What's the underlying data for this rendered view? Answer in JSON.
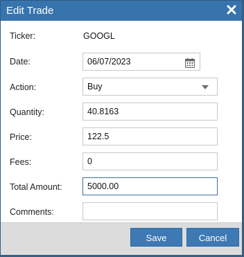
{
  "dialog": {
    "title": "Edit Trade",
    "close_icon": "close-icon"
  },
  "form": {
    "ticker_label": "Ticker:",
    "ticker_value": "GOOGL",
    "date_label": "Date:",
    "date_value": "06/07/2023",
    "date_icon": "calendar-icon",
    "action_label": "Action:",
    "action_value": "Buy",
    "quantity_label": "Quantity:",
    "quantity_value": "40.8163",
    "price_label": "Price:",
    "price_value": "122.5",
    "fees_label": "Fees:",
    "fees_value": "0",
    "total_label": "Total Amount:",
    "total_value": "5000.00",
    "comments_label": "Comments:",
    "comments_value": ""
  },
  "footer": {
    "save_label": "Save",
    "cancel_label": "Cancel"
  },
  "colors": {
    "titlebar": "#3774ad",
    "button": "#3e79b3",
    "footer": "#dcdcdc"
  }
}
